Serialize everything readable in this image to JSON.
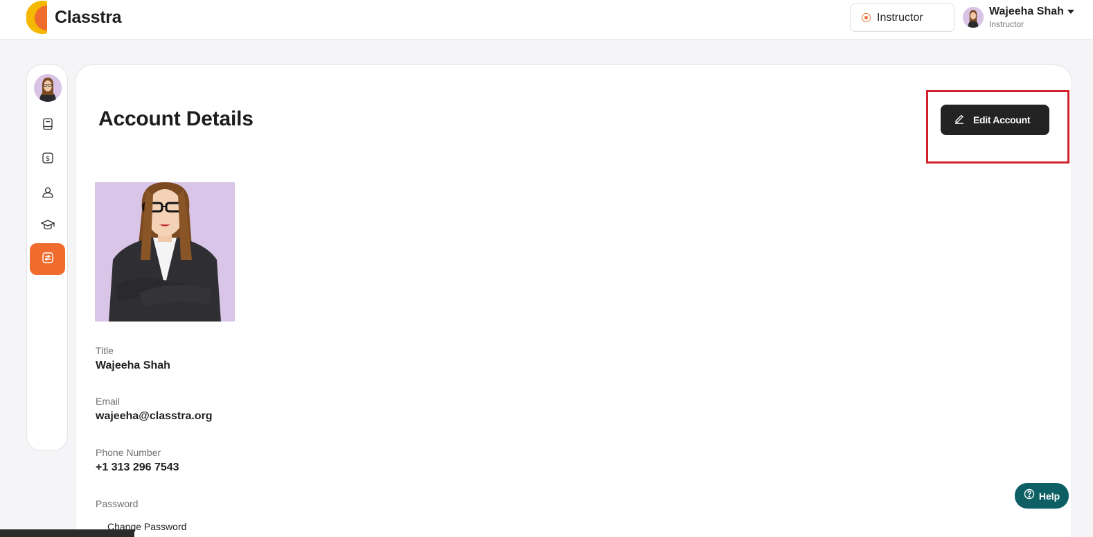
{
  "app": {
    "name": "Classtra",
    "brand_colors": {
      "orange": "#ef6c2e",
      "yellow": "#f5b800",
      "dark": "#232323",
      "help": "#0e5f63",
      "highlight": "#d1222b"
    }
  },
  "header": {
    "role_switch_label": "Instructor",
    "user": {
      "name": "Wajeeha Shah",
      "role": "Instructor"
    },
    "icons": {
      "role": "radio-dot-icon",
      "caret": "chevron-down-icon"
    }
  },
  "sidebar": {
    "items": [
      {
        "name": "courses",
        "icon": "book-icon",
        "active": false
      },
      {
        "name": "payments",
        "icon": "dollar-icon",
        "active": false
      },
      {
        "name": "students",
        "icon": "user-icon",
        "active": false
      },
      {
        "name": "education",
        "icon": "graduation-cap-icon",
        "active": false
      },
      {
        "name": "account",
        "icon": "settings-sliders-icon",
        "active": true
      }
    ]
  },
  "main": {
    "page_title": "Account Details",
    "edit_button_label": "Edit Account",
    "fields": [
      {
        "label": "Title",
        "value": "Wajeeha Shah"
      },
      {
        "label": "Email",
        "value": "wajeeha@classtra.org"
      },
      {
        "label": "Phone Number",
        "value": "+1 313 296 7543"
      },
      {
        "label": "Password",
        "action": "Change Password"
      }
    ]
  },
  "help": {
    "label": "Help",
    "icon": "question-circle-icon"
  }
}
